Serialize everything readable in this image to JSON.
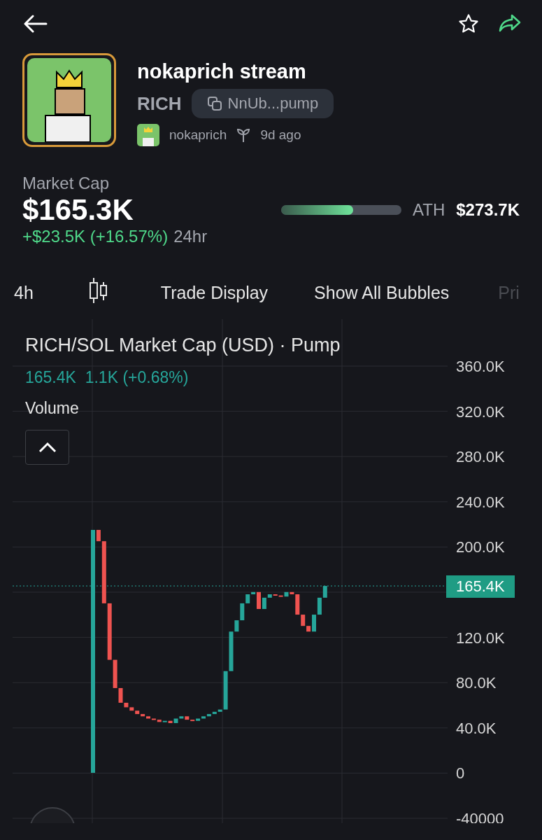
{
  "header": {
    "favorite": false
  },
  "token": {
    "name": "nokaprich stream",
    "ticker": "RICH",
    "address": "NnUb...pump",
    "creator": "nokaprich",
    "age": "9d ago"
  },
  "market_cap": {
    "label": "Market Cap",
    "value": "$165.3K",
    "change": "+$23.5K (+16.57%)",
    "period": "24hr",
    "ath_label": "ATH",
    "ath_value": "$273.7K",
    "level": 0.6
  },
  "toolbar": [
    {
      "kind": "text",
      "label": "4h",
      "faded": false
    },
    {
      "kind": "icon",
      "faded": false
    },
    {
      "kind": "text",
      "label": "Trade Display",
      "faded": false
    },
    {
      "kind": "text",
      "label": "Show All Bubbles",
      "faded": false
    },
    {
      "kind": "text",
      "label": "Pri",
      "faded": true
    }
  ],
  "chart": {
    "legend_value": "165.4K",
    "legend_change": "1.1K (+0.68%)",
    "volume_label": "Volume",
    "price_tag": "165.4K",
    "title": "RICH/SOL Market Cap (USD) · Pump",
    "y_labels": [
      "360.0K",
      "320.0K",
      "280.0K",
      "240.0K",
      "200.0K",
      "120.0K",
      "80.0K",
      "40.0K",
      "0",
      "-40000"
    ]
  }
}
